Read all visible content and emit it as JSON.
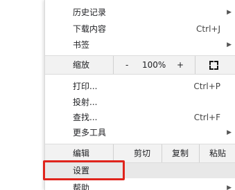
{
  "menu": {
    "history": {
      "label": "历史记录",
      "arrow": "▶"
    },
    "downloads": {
      "label": "下载内容",
      "shortcut": "Ctrl+J"
    },
    "bookmarks": {
      "label": "书签",
      "arrow": "▶"
    },
    "zoom": {
      "label": "缩放",
      "minus": "-",
      "value": "100%",
      "plus": "+",
      "fullscreen_icon": "fullscreen-icon"
    },
    "print": {
      "label": "打印...",
      "shortcut": "Ctrl+P"
    },
    "cast": {
      "label": "投射..."
    },
    "find": {
      "label": "查找...",
      "shortcut": "Ctrl+F"
    },
    "more_tools": {
      "label": "更多工具",
      "arrow": "▶"
    },
    "edit": {
      "label": "编辑",
      "cut": "剪切",
      "copy": "复制",
      "paste": "粘贴"
    },
    "settings": {
      "label": "设置"
    },
    "help": {
      "label": "帮助",
      "arrow": "▶"
    }
  },
  "colors": {
    "highlight_border": "#e0241c"
  }
}
